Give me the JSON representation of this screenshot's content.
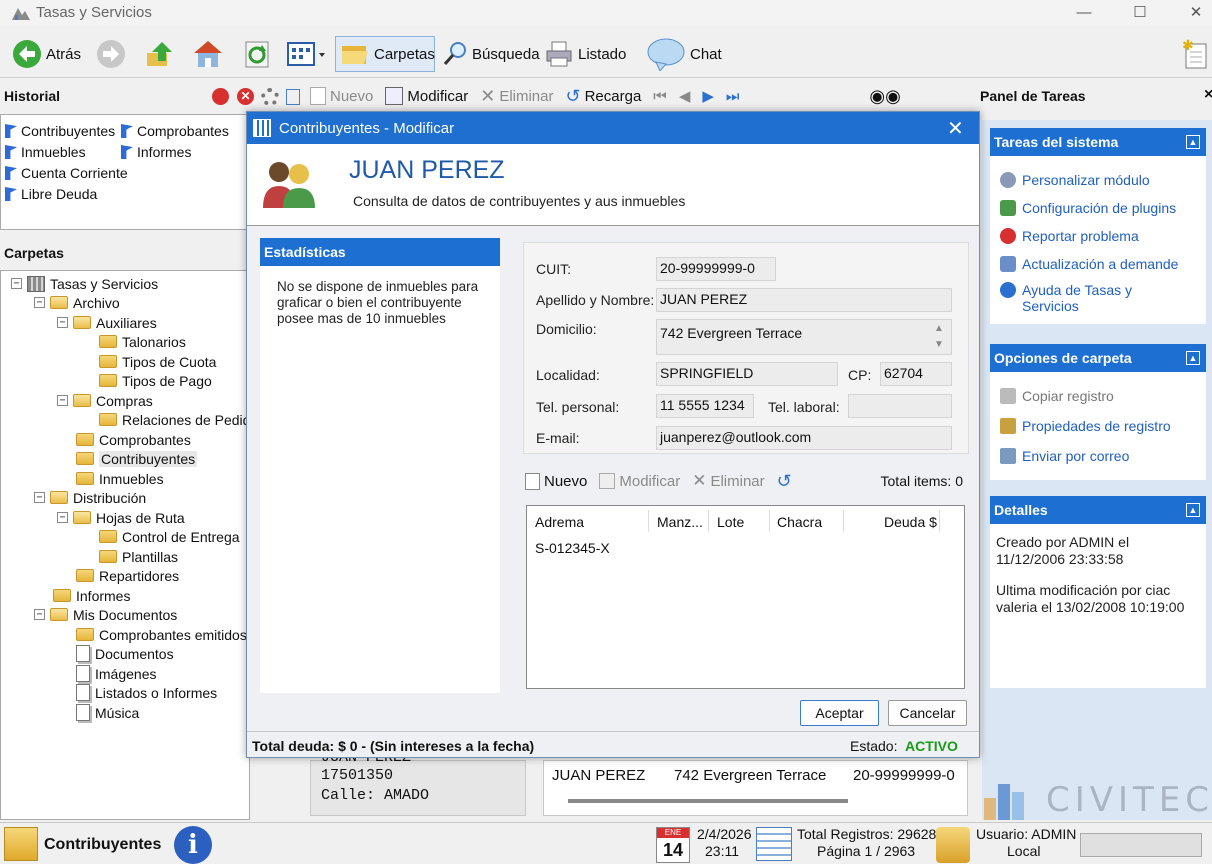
{
  "window": {
    "title": "Tasas y Servicios",
    "min": "—",
    "max": "☐",
    "close": "✕"
  },
  "toolbar": {
    "back": "Atrás",
    "folders": "Carpetas",
    "search": "Búsqueda",
    "list": "Listado",
    "chat": "Chat"
  },
  "historial": {
    "title": "Historial",
    "items": [
      "Contribuyentes",
      "Comprobantes",
      "Inmuebles",
      "Informes",
      "Cuenta Corriente",
      "Libre Deuda"
    ]
  },
  "carpetas": {
    "title": "Carpetas",
    "tree": [
      "Tasas y Servicios",
      "Archivo",
      "Auxiliares",
      "Talonarios",
      "Tipos de Cuota",
      "Tipos de Pago",
      "Compras",
      "Relaciones de Pedido",
      "Comprobantes",
      "Contribuyentes",
      "Inmuebles",
      "Distribución",
      "Hojas de Ruta",
      "Control de Entrega",
      "Plantillas",
      "Repartidores",
      "Informes",
      "Mis Documentos",
      "Comprobantes emitidos",
      "Documentos",
      "Imágenes",
      "Listados o Informes",
      "Música"
    ]
  },
  "innertoolbar": {
    "new": "Nuevo",
    "edit": "Modificar",
    "delete": "Eliminar",
    "reload": "Recarga"
  },
  "rightpanel": {
    "title": "Panel de Tareas",
    "close": "×",
    "system": {
      "title": "Tareas del sistema",
      "items": [
        "Personalizar módulo",
        "Configuración de plugins",
        "Reportar problema",
        "Actualización a demande",
        "Ayuda de Tasas y Servicios"
      ]
    },
    "folder_options": {
      "title": "Opciones de carpeta",
      "items": [
        "Copiar registro",
        "Propiedades de registro",
        "Enviar por correo"
      ]
    },
    "details": {
      "title": "Detalles",
      "created": "Creado por ADMIN el 11/12/2006 23:33:58",
      "modified": "Ultima modificación por ciac valeria el 13/02/2008 10:19:00"
    }
  },
  "background": {
    "card1_line0": "JUAN PEREZ",
    "card1_line1": "17501350",
    "card1_line2": "Calle: AMADO",
    "row_name": "JUAN PEREZ",
    "row_address": "742 Evergreen Terrace",
    "row_cuit": "20-99999999-0",
    "logo": "CIVITEC"
  },
  "statusbar": {
    "module": "Contribuyentes",
    "cal_month": "ENE",
    "cal_day": "14",
    "date": "2/4/2026",
    "time": "23:11",
    "total": "Total Registros: 29628",
    "page": "Página 1 / 2963",
    "user": "Usuario: ADMIN",
    "location": "Local"
  },
  "dialog": {
    "title": "Contribuyentes - Modificar",
    "name": "JUAN PEREZ",
    "subtitle": "Consulta de datos de contribuyentes y aus inmuebles",
    "stats_title": "Estadísticas",
    "stats_text": "No se dispone de inmuebles para graficar o bien el contribuyente posee mas de 10 inmuebles",
    "labels": {
      "cuit": "CUIT:",
      "name": "Apellido y Nombre:",
      "address": "Domicilio:",
      "city": "Localidad:",
      "cp": "CP:",
      "phone": "Tel. personal:",
      "work_phone": "Tel. laboral:",
      "email": "E-mail:"
    },
    "values": {
      "cuit": "20-99999999-0",
      "name": "JUAN PEREZ",
      "address": "742 Evergreen Terrace",
      "city": "SPRINGFIELD",
      "cp": "62704",
      "phone": "11 5555 1234",
      "work_phone": "",
      "email": "juanperez@outlook.com"
    },
    "subtoolbar": {
      "new": "Nuevo",
      "edit": "Modificar",
      "delete": "Eliminar",
      "total": "Total items: 0"
    },
    "columns": [
      "Adrema",
      "Manz...",
      "Lote",
      "Chacra",
      "Deuda $"
    ],
    "rows": [
      [
        "S-012345-X",
        "",
        "",
        "",
        ""
      ]
    ],
    "ok": "Aceptar",
    "cancel": "Cancelar",
    "total_debt": "Total deuda: $ 0 - (Sin intereses a la fecha)",
    "status_label": "Estado:",
    "status_value": "ACTIVO"
  },
  "colors": {
    "accent": "#1d6fd1",
    "status_active": "#1a9a1a"
  }
}
